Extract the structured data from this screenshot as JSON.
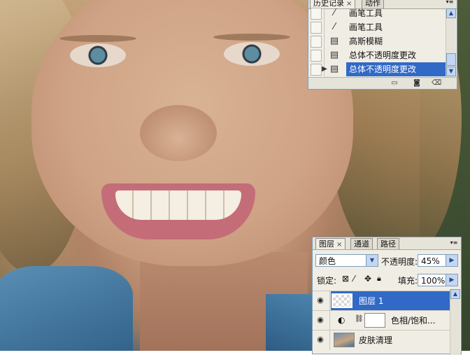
{
  "history_panel": {
    "tabs": [
      {
        "label": "历史记录",
        "close": "×"
      },
      {
        "label": "动作"
      }
    ],
    "items": [
      {
        "label": "画笔工具",
        "icon": "brush-icon"
      },
      {
        "label": "画笔工具",
        "icon": "brush-icon"
      },
      {
        "label": "高斯模糊",
        "icon": "history-state-icon"
      },
      {
        "label": "总体不透明度更改",
        "icon": "history-state-icon"
      },
      {
        "label": "总体不透明度更改",
        "icon": "history-state-icon",
        "selected": true
      }
    ]
  },
  "layers_panel": {
    "tabs": [
      {
        "label": "图层",
        "close": "×"
      },
      {
        "label": "通道"
      },
      {
        "label": "路径"
      }
    ],
    "blend_mode": "颜色",
    "opacity_label": "不透明度:",
    "opacity_value": "45%",
    "lock_label": "锁定:",
    "fill_label": "填充:",
    "fill_value": "100%",
    "layers": [
      {
        "name": "图层 1",
        "visible": true,
        "selected": true
      },
      {
        "name": "色相/饱和...",
        "visible": true,
        "adjustment": true
      },
      {
        "name": "皮肤清理",
        "visible": true
      }
    ]
  },
  "colors": {
    "selection": "#3169c6",
    "panel_bg": "#f0ede4"
  }
}
